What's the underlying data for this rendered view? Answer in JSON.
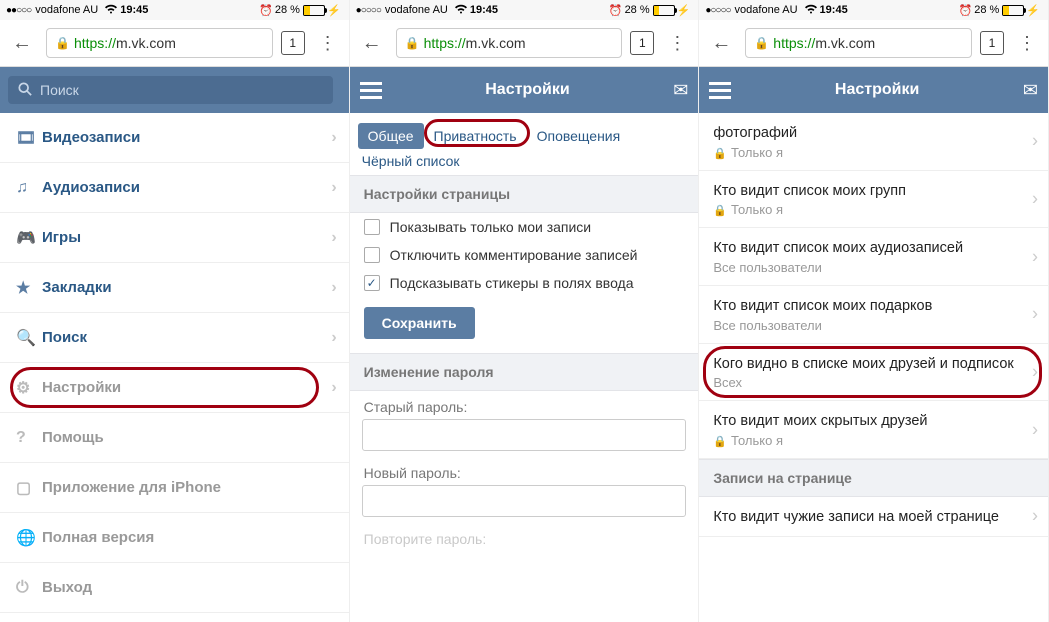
{
  "status": {
    "carrier": "vodafone AU",
    "time": "19:45",
    "battery_pct": "28 %"
  },
  "browser": {
    "scheme": "https://",
    "host": "m.vk.com",
    "tab_count": "1"
  },
  "pane1": {
    "search_placeholder": "Поиск",
    "menu": [
      {
        "label": "Видеозаписи"
      },
      {
        "label": "Аудиозаписи"
      },
      {
        "label": "Игры"
      },
      {
        "label": "Закладки"
      },
      {
        "label": "Поиск"
      },
      {
        "label": "Настройки"
      },
      {
        "label": "Помощь"
      },
      {
        "label": "Приложение для iPhone"
      },
      {
        "label": "Полная версия"
      },
      {
        "label": "Выход"
      }
    ]
  },
  "pane2": {
    "header": "Настройки",
    "tabs": {
      "general": "Общее",
      "privacy": "Приватность",
      "notifications": "Оповещения",
      "blacklist": "Чёрный список"
    },
    "section_page": "Настройки страницы",
    "chk_only_my": "Показывать только мои записи",
    "chk_disable_comments": "Отключить комментирование записей",
    "chk_suggest_stickers": "Подсказывать стикеры в полях ввода",
    "save": "Сохранить",
    "section_pw": "Изменение пароля",
    "old_pw": "Старый пароль:",
    "new_pw": "Новый пароль:",
    "repeat_pw": "Повторите пароль:"
  },
  "pane3": {
    "header": "Настройки",
    "items": [
      {
        "title": "фотографий",
        "value": "Только я",
        "locked": true
      },
      {
        "title": "Кто видит список моих групп",
        "value": "Только я",
        "locked": true
      },
      {
        "title": "Кто видит список моих аудиозаписей",
        "value": "Все пользователи",
        "locked": false
      },
      {
        "title": "Кто видит список моих подарков",
        "value": "Все пользователи",
        "locked": false
      },
      {
        "title": "Кого видно в списке моих друзей и подписок",
        "value": "Всех",
        "locked": false
      },
      {
        "title": "Кто видит моих скрытых друзей",
        "value": "Только я",
        "locked": true
      }
    ],
    "section_wall": "Записи на странице",
    "wall_item": "Кто видит чужие записи на моей странице"
  }
}
